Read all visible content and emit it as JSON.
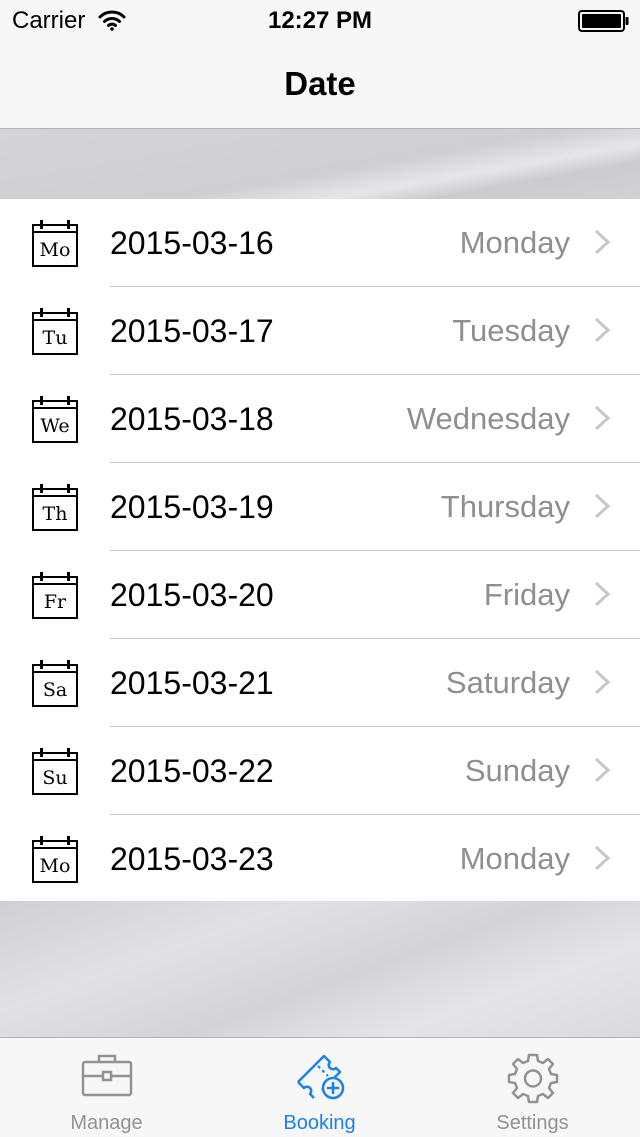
{
  "status_bar": {
    "carrier": "Carrier",
    "time": "12:27 PM"
  },
  "nav": {
    "title": "Date"
  },
  "dates": [
    {
      "icon": "Mo",
      "date": "2015-03-16",
      "weekday": "Monday"
    },
    {
      "icon": "Tu",
      "date": "2015-03-17",
      "weekday": "Tuesday"
    },
    {
      "icon": "We",
      "date": "2015-03-18",
      "weekday": "Wednesday"
    },
    {
      "icon": "Th",
      "date": "2015-03-19",
      "weekday": "Thursday"
    },
    {
      "icon": "Fr",
      "date": "2015-03-20",
      "weekday": "Friday"
    },
    {
      "icon": "Sa",
      "date": "2015-03-21",
      "weekday": "Saturday"
    },
    {
      "icon": "Su",
      "date": "2015-03-22",
      "weekday": "Sunday"
    },
    {
      "icon": "Mo",
      "date": "2015-03-23",
      "weekday": "Monday"
    }
  ],
  "tabs": [
    {
      "label": "Manage",
      "icon": "briefcase-icon",
      "active": false
    },
    {
      "label": "Booking",
      "icon": "ticket-add-icon",
      "active": true
    },
    {
      "label": "Settings",
      "icon": "gear-icon",
      "active": false
    }
  ],
  "colors": {
    "accent": "#1b7ff5",
    "inactive_tab": "#929292",
    "secondary_text": "#8e8e93"
  }
}
